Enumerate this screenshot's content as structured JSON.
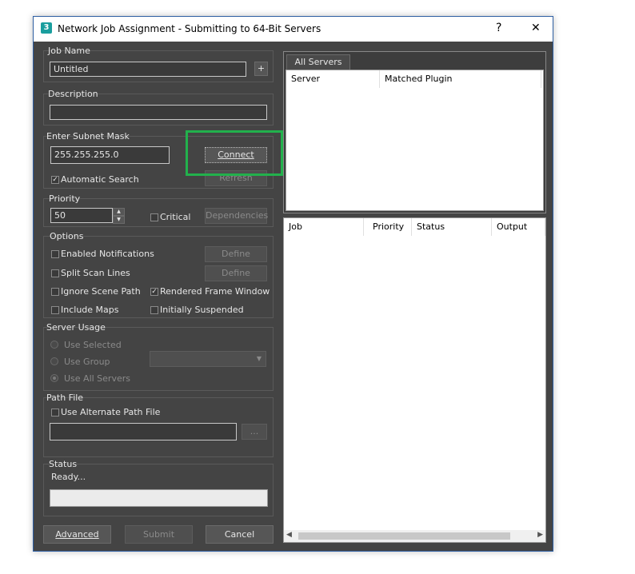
{
  "window": {
    "title": "Network Job Assignment - Submitting to 64-Bit Servers",
    "app_icon_glyph": "3",
    "help_glyph": "?",
    "close_glyph": "✕"
  },
  "job_name": {
    "label": "Job Name",
    "value": "Untitled",
    "add_label": "+"
  },
  "description": {
    "label": "Description",
    "value": ""
  },
  "subnet": {
    "label": "Enter Subnet Mask",
    "value": "255.255.255.0",
    "connect_label": "Connect",
    "refresh_label": "Refresh",
    "auto_search_label": "Automatic Search",
    "auto_search_checked": true
  },
  "priority": {
    "label": "Priority",
    "value": "50",
    "critical_label": "Critical",
    "dependencies_label": "Dependencies"
  },
  "options": {
    "label": "Options",
    "enabled_notifications": "Enabled Notifications",
    "split_scan_lines": "Split Scan Lines",
    "define_label": "Define",
    "ignore_scene_path": "Ignore Scene Path",
    "rendered_frame_window": "Rendered Frame Window",
    "include_maps": "Include Maps",
    "initially_suspended": "Initially Suspended"
  },
  "server_usage": {
    "label": "Server Usage",
    "use_selected": "Use Selected",
    "use_group": "Use Group",
    "use_all_servers": "Use All Servers"
  },
  "path_file": {
    "label": "Path File",
    "use_alternate": "Use Alternate Path File",
    "value": "",
    "browse_label": "..."
  },
  "status": {
    "label": "Status",
    "text": "Ready..."
  },
  "footer": {
    "advanced": "Advanced",
    "submit": "Submit",
    "cancel": "Cancel"
  },
  "servers_panel": {
    "tab": "All Servers",
    "columns": [
      "Server",
      "Matched Plugin"
    ]
  },
  "jobs_panel": {
    "columns": [
      "Job",
      "Priority",
      "Status",
      "Output"
    ]
  },
  "colors": {
    "accent_highlight": "#22b14c",
    "window_bg": "#444444"
  }
}
